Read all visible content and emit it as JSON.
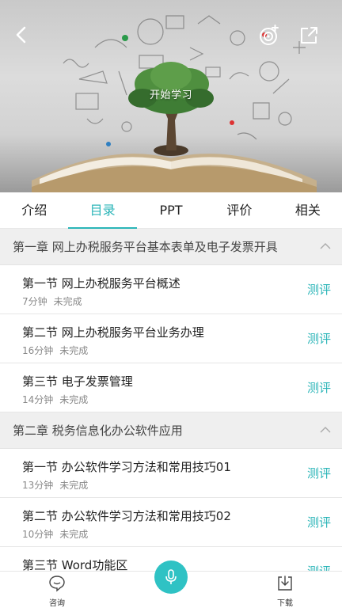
{
  "hero": {
    "start_label": "开始学习",
    "back_icon": "chevron-left-icon",
    "right_icons": [
      "record-icon",
      "share-icon"
    ]
  },
  "tabs": [
    {
      "label": "介绍",
      "active": false
    },
    {
      "label": "目录",
      "active": true
    },
    {
      "label": "PPT",
      "active": false
    },
    {
      "label": "评价",
      "active": false
    },
    {
      "label": "相关",
      "active": false
    }
  ],
  "chapters": [
    {
      "title": "第一章 网上办税服务平台基本表单及电子发票开具",
      "sections": [
        {
          "name": "第一节 网上办税服务平台概述",
          "duration": "7分钟",
          "status": "未完成",
          "action": "测评"
        },
        {
          "name": "第二节 网上办税服务平台业务办理",
          "duration": "16分钟",
          "status": "未完成",
          "action": "测评"
        },
        {
          "name": "第三节 电子发票管理",
          "duration": "14分钟",
          "status": "未完成",
          "action": "测评"
        }
      ]
    },
    {
      "title": "第二章 税务信息化办公软件应用",
      "sections": [
        {
          "name": "第一节 办公软件学习方法和常用技巧01",
          "duration": "13分钟",
          "status": "未完成",
          "action": "测评"
        },
        {
          "name": "第二节 办公软件学习方法和常用技巧02",
          "duration": "10分钟",
          "status": "未完成",
          "action": "测评"
        },
        {
          "name": "第三节 Word功能区",
          "duration": "",
          "status": "",
          "action": "测评"
        }
      ]
    }
  ],
  "bottom_bar": {
    "consult_label": "咨询",
    "download_label": "下载"
  },
  "colors": {
    "accent": "#2bb5b8",
    "mic": "#2fc2c4"
  }
}
